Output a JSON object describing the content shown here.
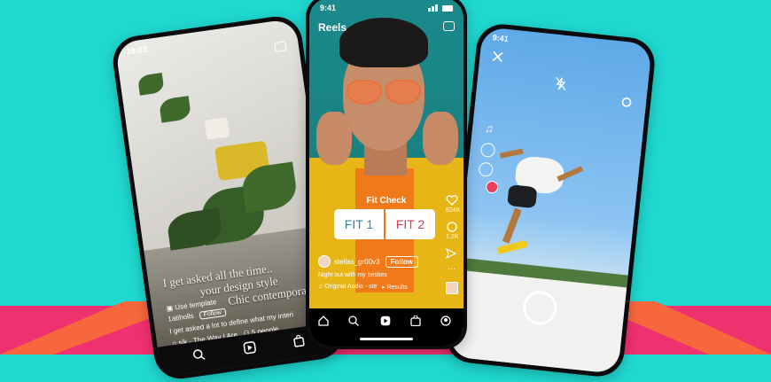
{
  "colors": {
    "background": "#1fd8d0",
    "stripe": "#f0316f",
    "fit1": "#2c83a8",
    "fit2": "#d63a4a"
  },
  "left_phone": {
    "time": "16:23",
    "quote_lines": [
      "I get asked all the time..",
      "your design style",
      "Chic contempora"
    ],
    "use_template": "Use template",
    "username": "1atiholls",
    "follow": "Follow",
    "caption": "I get asked a lot to define what my interi",
    "audio": "sik · The Way I Are",
    "people": "5 people"
  },
  "center_phone": {
    "time": "9:41",
    "title": "Reels",
    "fit_check": "Fit Check",
    "fit1": "FIT 1",
    "fit2": "FIT 2",
    "username": "stellas_gr00v3",
    "follow": "Follow",
    "caption": "Night out with my besties",
    "audio": "Original Audio - ste",
    "results": "Results",
    "like_count": "824K",
    "comment_count": "1.2K"
  },
  "right_phone": {
    "time": "9:41"
  },
  "icons": [
    "camera-icon",
    "heart-icon",
    "comment-icon",
    "send-icon",
    "more-icon",
    "home-icon",
    "search-icon",
    "reels-icon",
    "shop-icon",
    "profile-icon",
    "close-icon",
    "flash-off-icon",
    "settings-icon",
    "music-icon",
    "speed-icon",
    "timer-icon",
    "shutter-icon"
  ]
}
